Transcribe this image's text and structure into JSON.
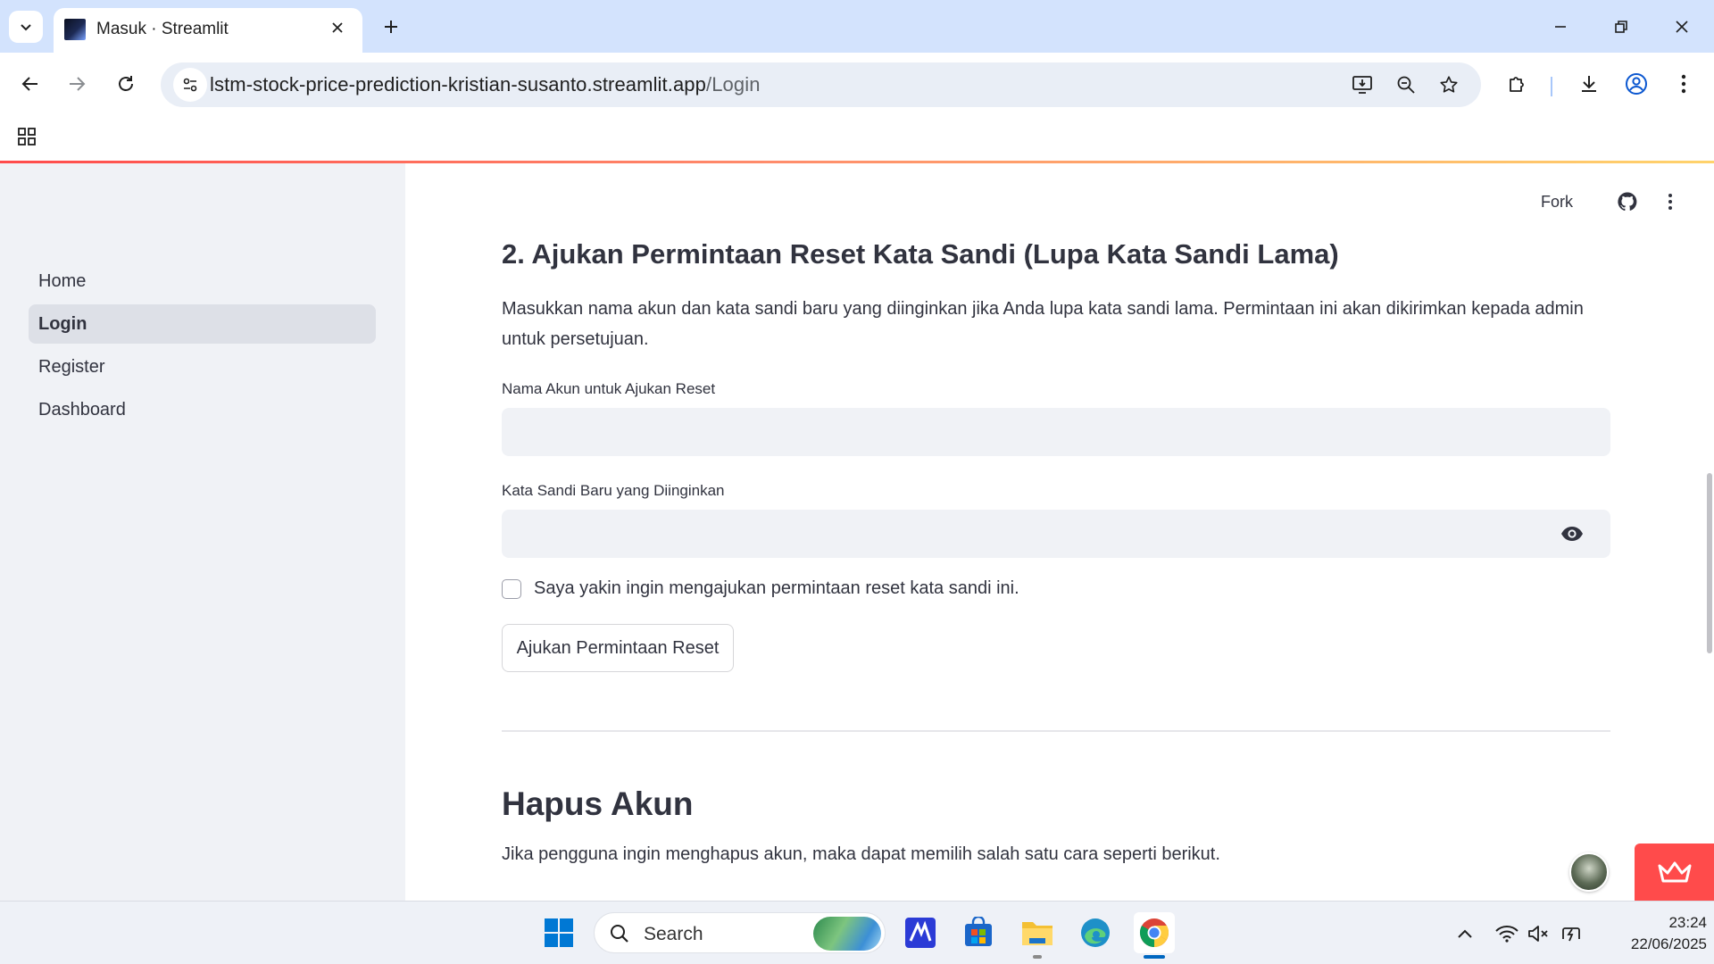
{
  "browser": {
    "tab_title": "Masuk · Streamlit",
    "url_host": "lstm-stock-price-prediction-kristian-susanto.streamlit.app",
    "url_path": "/Login"
  },
  "header": {
    "fork_label": "Fork"
  },
  "sidebar": {
    "items": [
      {
        "label": "Home",
        "active": false
      },
      {
        "label": "Login",
        "active": true
      },
      {
        "label": "Register",
        "active": false
      },
      {
        "label": "Dashboard",
        "active": false
      }
    ]
  },
  "reset_section": {
    "heading": "2. Ajukan Permintaan Reset Kata Sandi (Lupa Kata Sandi Lama)",
    "description": "Masukkan nama akun dan kata sandi baru yang diinginkan jika Anda lupa kata sandi lama. Permintaan ini akan dikirimkan kepada admin untuk persetujuan.",
    "username_label": "Nama Akun untuk Ajukan Reset",
    "username_value": "",
    "password_label": "Kata Sandi Baru yang Diinginkan",
    "password_value": "",
    "confirm_label": "Saya yakin ingin mengajukan permintaan reset kata sandi ini.",
    "confirm_checked": false,
    "submit_label": "Ajukan Permintaan Reset"
  },
  "delete_section": {
    "heading": "Hapus Akun",
    "description": "Jika pengguna ingin menghapus akun, maka dapat memilih salah satu cara seperti berikut."
  },
  "taskbar": {
    "search_placeholder": "Search",
    "time": "23:24",
    "date": "22/06/2025"
  },
  "colors": {
    "accent": "#ff4b4b",
    "sidebar_bg": "#f0f2f6",
    "input_bg": "#f0f2f6",
    "browser_frame": "#d3e3fd"
  }
}
